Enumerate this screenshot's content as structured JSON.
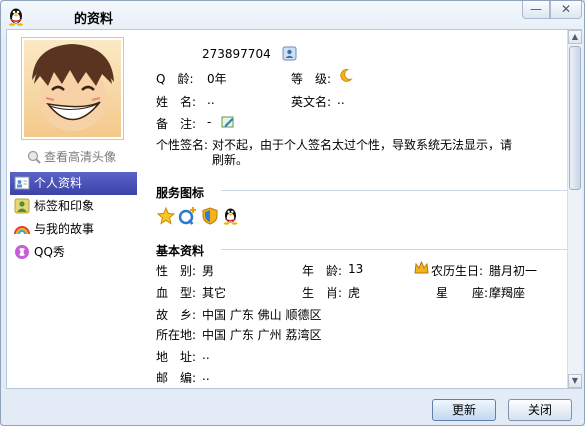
{
  "window": {
    "title": "的资料",
    "minimize_glyph": "—",
    "close_glyph": "✕"
  },
  "left": {
    "hd_avatar_link": "查看高清头像",
    "nav": [
      {
        "label": "个人资料",
        "icon": "profile-card-icon",
        "active": true
      },
      {
        "label": "标签和印象",
        "icon": "tag-person-icon",
        "active": false
      },
      {
        "label": "与我的故事",
        "icon": "rainbow-icon",
        "active": false
      },
      {
        "label": "QQ秀",
        "icon": "qq-show-icon",
        "active": false
      }
    ]
  },
  "profile": {
    "qq_number": "273897704",
    "q_age_label": "Q　龄:",
    "q_age_value": "0年",
    "level_label": "等　级:",
    "name_label": "姓　名:",
    "name_value": "..",
    "english_name_label": "英文名:",
    "english_name_value": "..",
    "note_label": "备　注:",
    "note_value": "-",
    "signature_label": "个性签名:",
    "signature_line1": "对不起，由于个人签名太过个性，导致系统无法显示，请",
    "signature_line2": "刷新。"
  },
  "service_icons": {
    "heading": "服务图标",
    "icons": [
      "star-icon",
      "q-plus-icon",
      "shield-icon",
      "qq-penguin-icon"
    ]
  },
  "basic_info": {
    "heading": "基本资料",
    "gender_label": "性　别:",
    "gender_value": "男",
    "age_label": "年　龄:",
    "age_value": "13",
    "lunar_birthday_label": "农历生日:",
    "lunar_birthday_value": "腊月初一",
    "blood_label": "血　型:",
    "blood_value": "其它",
    "zodiac_label": "生　肖:",
    "zodiac_value": "虎",
    "constellation_label": "星　　座:",
    "constellation_value": "摩羯座",
    "hometown_label": "故　乡:",
    "hometown_value": "中国 广东 佛山 顺德区",
    "location_label": "所在地:",
    "location_value": "中国 广东 广州 荔湾区",
    "address_label": "地　址:",
    "address_value": "..",
    "postcode_label": "邮　编:",
    "postcode_value": ".."
  },
  "buttons": {
    "refresh": "更新",
    "close": "关闭"
  },
  "colors": {
    "accent": "#3b43a8",
    "rule": "#c9d8ea",
    "link_gray": "#7a7a7a"
  }
}
